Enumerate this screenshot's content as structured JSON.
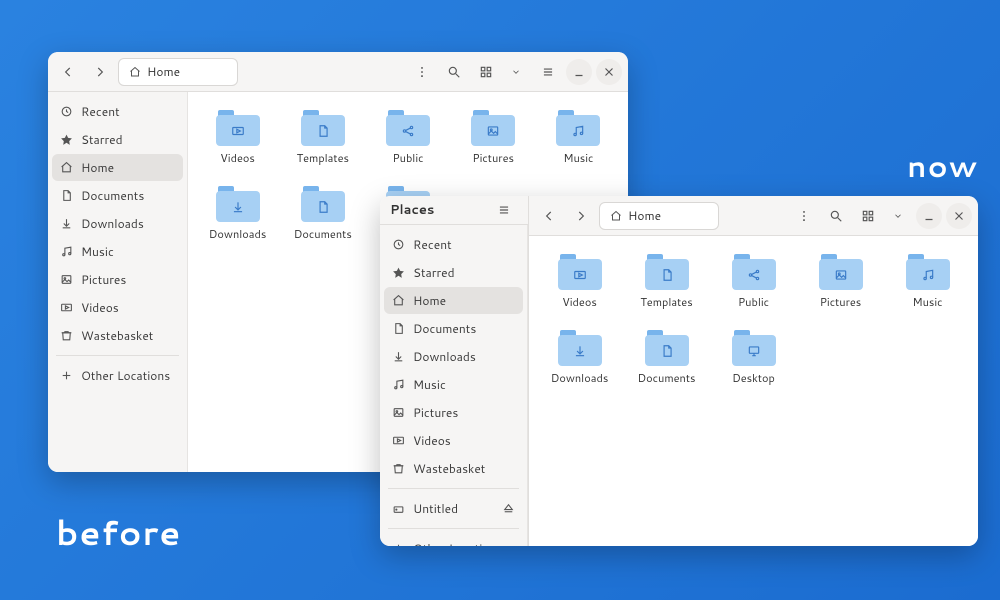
{
  "annotations": {
    "before": "before",
    "now": "now"
  },
  "common": {
    "path_label": "Home",
    "sidebar": {
      "recent": "Recent",
      "starred": "Starred",
      "home": "Home",
      "documents": "Documents",
      "downloads": "Downloads",
      "music": "Music",
      "pictures": "Pictures",
      "videos": "Videos",
      "wastebasket": "Wastebasket",
      "other_locations": "Other Locations"
    },
    "folders": {
      "videos": "Videos",
      "templates": "Templates",
      "public": "Public",
      "pictures": "Pictures",
      "music": "Music",
      "downloads": "Downloads",
      "documents": "Documents",
      "desktop": "Desktop"
    }
  },
  "now": {
    "sidebar_title": "Places",
    "untitled": "Untitled"
  }
}
